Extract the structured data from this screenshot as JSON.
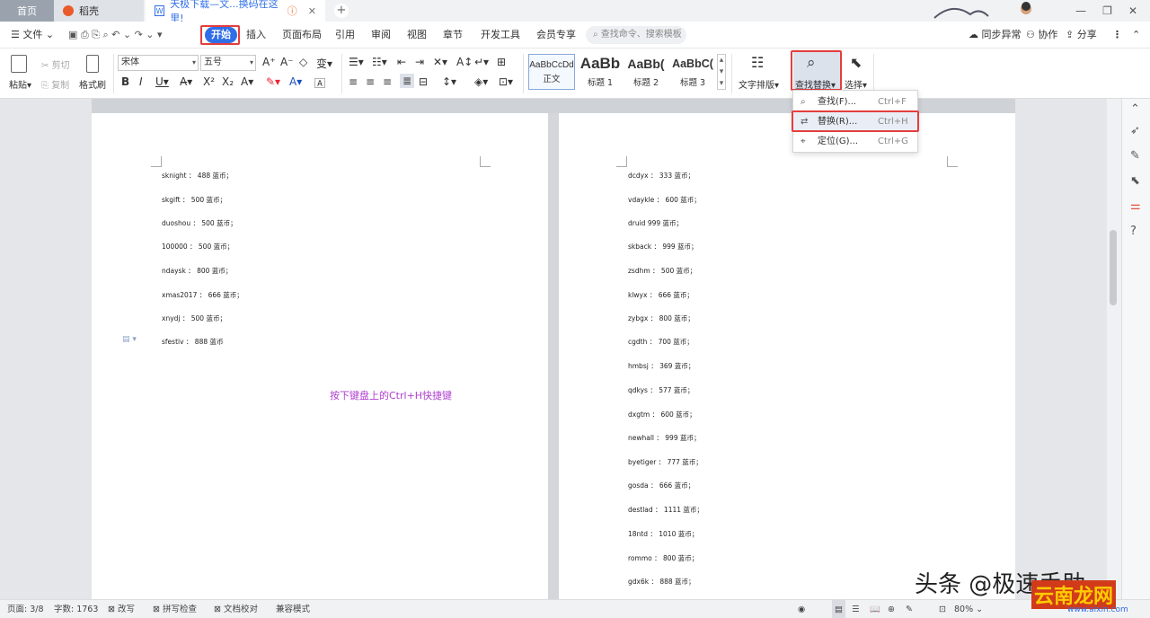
{
  "tabs": [
    {
      "label": "首页"
    },
    {
      "label": "稻壳"
    },
    {
      "label": "天极下载—文...换码在这里!"
    }
  ],
  "menu": {
    "file": "文件",
    "items": [
      "开始",
      "插入",
      "页面布局",
      "引用",
      "审阅",
      "视图",
      "章节",
      "开发工具",
      "会员专享"
    ],
    "search_placeholder": "查找命令、搜索模板",
    "right": [
      "同步异常",
      "协作",
      "分享"
    ]
  },
  "ribbon": {
    "paste": "粘贴",
    "cut": "剪切",
    "copy": "复制",
    "format_painter": "格式刷",
    "font_name": "宋体",
    "font_size": "五号",
    "styles": [
      {
        "preview": "AaBbCcDd",
        "label": "正文"
      },
      {
        "preview": "AaBb",
        "label": "标题 1"
      },
      {
        "preview": "AaBb(",
        "label": "标题 2"
      },
      {
        "preview": "AaBbC(",
        "label": "标题 3"
      }
    ],
    "text_layout": "文字排版",
    "find_replace": "查找替换",
    "select": "选择"
  },
  "dropdown": [
    {
      "label": "查找(F)...",
      "shortcut": "Ctrl+F"
    },
    {
      "label": "替换(R)...",
      "shortcut": "Ctrl+H"
    },
    {
      "label": "定位(G)...",
      "shortcut": "Ctrl+G"
    }
  ],
  "document": {
    "left_lines": [
      "sknight ： 488 蓝币；",
      "skgift ： 500 蓝币；",
      "duoshou ： 500 蓝币；",
      "100000 ： 500 蓝币；",
      "ndaysk ： 800 蓝币；",
      "xmas2017 ： 666 蓝币；",
      "xnydj ： 500 蓝币；",
      "sfestiv ： 888 蓝币"
    ],
    "hint": "按下键盘上的Ctrl+H快捷键",
    "right_lines": [
      "dcdyx ： 333 蓝币；",
      "vdaykle ： 600 蓝币；",
      "druid 999 蓝币；",
      "skback ： 999 蓝币；",
      "zsdhm ： 500 蓝币；",
      "klwyx ： 666 蓝币；",
      "zybgx ： 800 蓝币；",
      "cgdth ： 700 蓝币；",
      "hmbsj ： 369 蓝币；",
      "qdkys ： 577 蓝币；",
      "dxgtm ： 600 蓝币；",
      "newhall ： 999 蓝币；",
      "byetiger ： 777 蓝币；",
      "gosda ： 666 蓝币；",
      "destlad ： 1111 蓝币；",
      "18ntd ： 1010 蓝币；",
      "rommo ： 800 蓝币；",
      "gdx6k ： 888 蓝币；"
    ]
  },
  "status": {
    "page": "页面: 3/8",
    "words": "字数: 1763",
    "revise": "改写",
    "spell": "拼写检查",
    "proof": "文档校对",
    "compat": "兼容模式",
    "zoom": "80%"
  },
  "watermark": {
    "text": "头条 @极速手助",
    "brand": "云南龙网",
    "url": "www.aixin.com"
  },
  "colors": {
    "accent": "#2f6ee8",
    "highlight_box": "#e53d3d",
    "hint_text": "#b040d0"
  }
}
